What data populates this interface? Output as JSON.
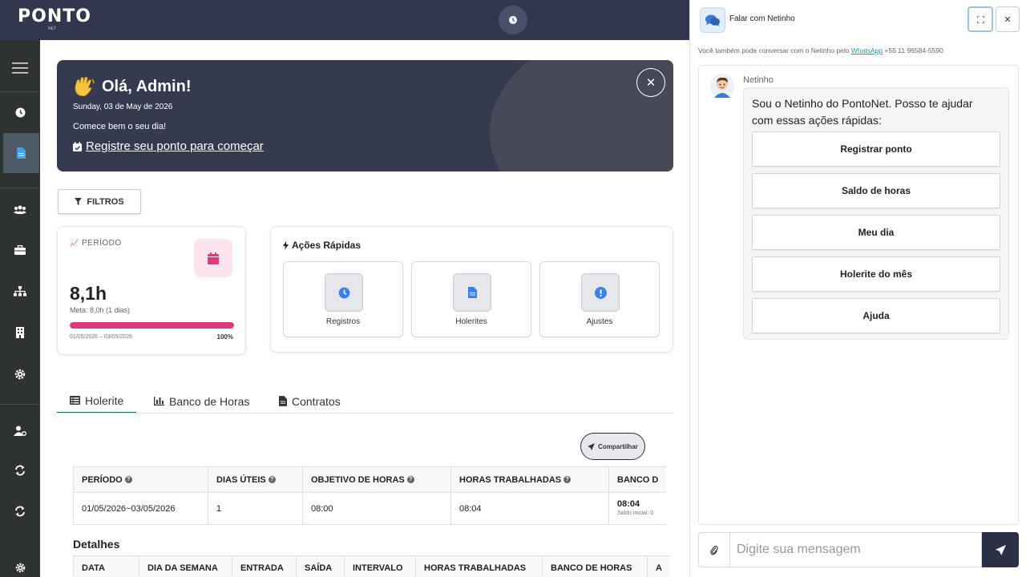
{
  "header": {
    "logo_text": "PONTO",
    "logo_sub": "NET"
  },
  "welcome": {
    "greeting": "Olá, Admin!",
    "date": "Sunday, 03 de May de 2026",
    "message": "Comece bem o seu dia!",
    "link": "Registre seu ponto para começar"
  },
  "filters": {
    "label": "FILTROS"
  },
  "period": {
    "label": "PERÍODO",
    "value": "8,1h",
    "meta": "Meta: 8,0h (1 dias)",
    "progress": 1.0,
    "range": "01/05/2026 – 03/05/2026",
    "percent": "100%",
    "accent": "#de3a7d"
  },
  "quick_actions": {
    "title": "Ações Rápidas",
    "items": [
      {
        "label": "Registros",
        "icon": "clock-icon"
      },
      {
        "label": "Holerites",
        "icon": "document-icon"
      },
      {
        "label": "Ajustes",
        "icon": "alert-icon"
      }
    ]
  },
  "tabs": [
    {
      "label": "Holerite",
      "icon": "list-icon",
      "active": true
    },
    {
      "label": "Banco de Horas",
      "icon": "bar-chart-icon",
      "active": false
    },
    {
      "label": "Contratos",
      "icon": "file-icon",
      "active": false
    }
  ],
  "share": {
    "label": "Compartilhar"
  },
  "summary_table": {
    "headers": [
      "PERÍODO",
      "DIAS ÚTEIS",
      "OBJETIVO DE HORAS",
      "HORAS TRABALHADAS",
      "BANCO D"
    ],
    "row": [
      "01/05/2026~03/05/2026",
      "1",
      "08:00",
      "08:04",
      "08:04"
    ],
    "bank_sub": "Saldo inicial: 0"
  },
  "details": {
    "title": "Detalhes",
    "headers": [
      "DATA",
      "DIA DA SEMANA",
      "ENTRADA",
      "SAÍDA",
      "INTERVALO",
      "HORAS TRABALHADAS",
      "BANCO DE HORAS",
      "A"
    ]
  },
  "chat": {
    "title": "Falar com Netinho",
    "note_prefix": "Você também pode conversar com o Netinho pelo",
    "note_link": "WhatsApp",
    "note_phone": "+55 11 96584-5590",
    "bot_name": "Netinho",
    "bot_message": "Sou o Netinho do PontoNet. Posso te ajudar com essas ações rápidas:",
    "actions": [
      "Registrar ponto",
      "Saldo de horas",
      "Meu dia",
      "Holerite do mês",
      "Ajuda"
    ],
    "input_placeholder": "Digite sua mensagem"
  },
  "colors": {
    "header_bg": "#33374d",
    "sidebar_bg": "#2f3233",
    "tab_active": "#1c6e4e",
    "link": "#1a9bb0"
  }
}
